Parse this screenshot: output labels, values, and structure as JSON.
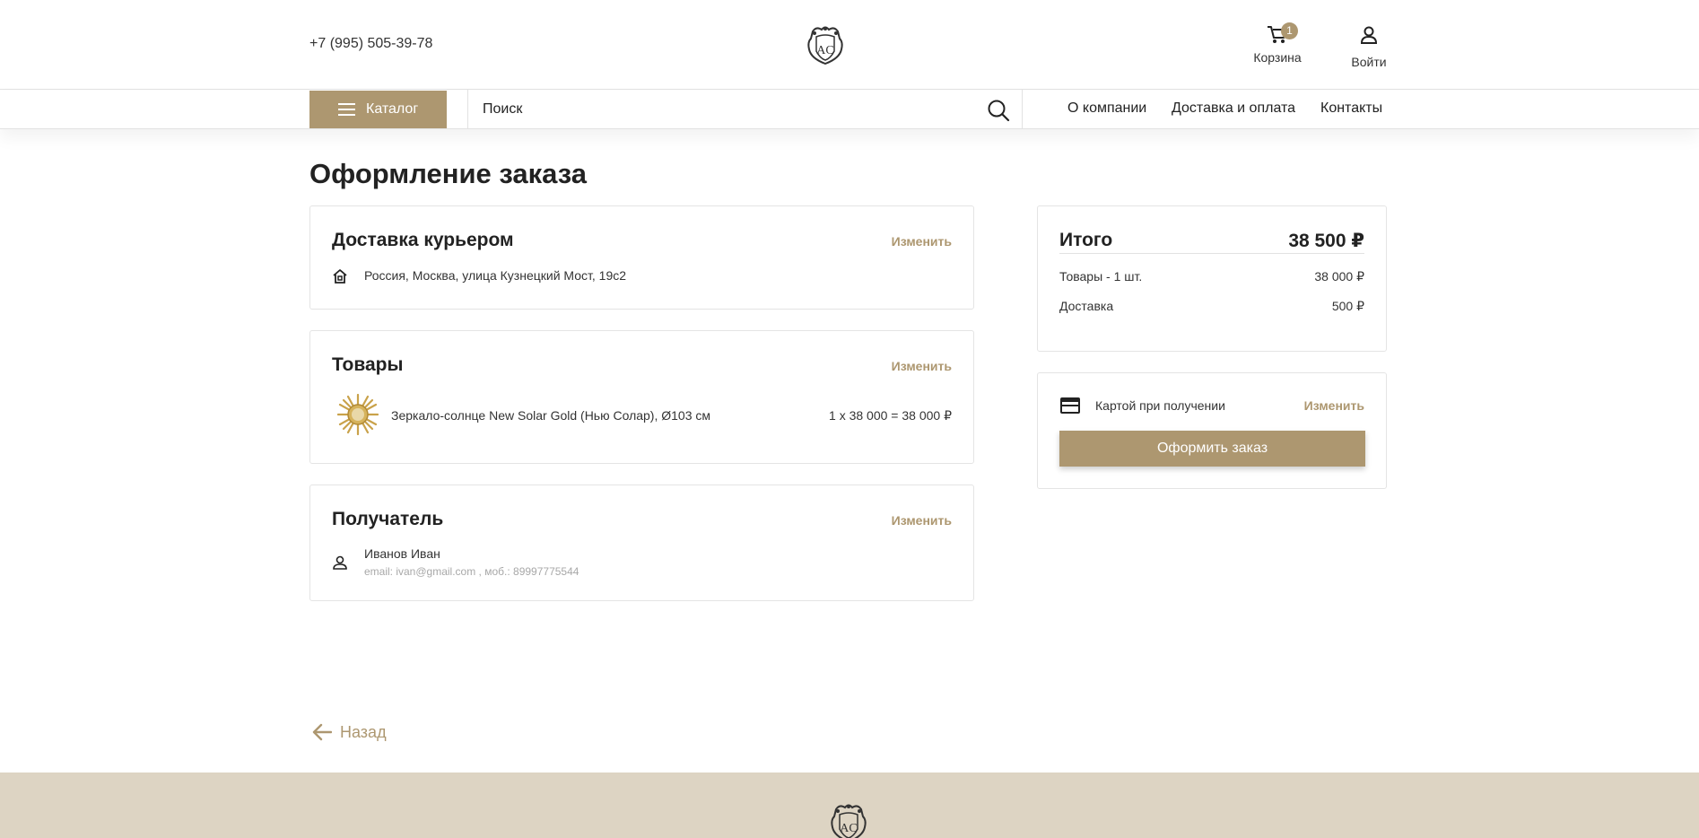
{
  "header": {
    "phone": "+7 (995) 505-39-78",
    "cart_label": "Корзина",
    "cart_count": "1",
    "login_label": "Войти"
  },
  "nav": {
    "catalog_label": "Каталог",
    "search_placeholder": "Поиск",
    "links": [
      "О компании",
      "Доставка и оплата",
      "Контакты"
    ]
  },
  "page": {
    "title": "Оформление заказа",
    "back_label": "Назад"
  },
  "delivery": {
    "title": "Доставка курьером",
    "edit_label": "Изменить",
    "address": "Россия, Москва, улица Кузнецкий Мост, 19с2"
  },
  "goods": {
    "title": "Товары",
    "edit_label": "Изменить",
    "items": [
      {
        "name": "Зеркало-солнце New Solar Gold (Нью Солар), Ø103 см",
        "price_line": "1 x 38 000 = 38 000 ₽"
      }
    ]
  },
  "recipient": {
    "title": "Получатель",
    "edit_label": "Изменить",
    "name": "Иванов Иван",
    "contacts": "email: ivan@gmail.com , моб.: 89997775544"
  },
  "summary": {
    "title": "Итого",
    "total": "38 500 ₽",
    "rows": [
      {
        "label": "Товары - 1 шт.",
        "value": "38 000 ₽"
      },
      {
        "label": "Доставка",
        "value": "500 ₽"
      }
    ]
  },
  "payment": {
    "method": "Картой при получении",
    "edit_label": "Изменить",
    "checkout_label": "Оформить заказ"
  },
  "colors": {
    "accent": "#ad9770",
    "footer_bg": "#ddd4c3",
    "text": "#222222",
    "muted": "#a8a8a8"
  },
  "icons": [
    "logo-crest-icon",
    "cart-icon",
    "user-icon",
    "menu-icon",
    "search-icon",
    "home-icon",
    "person-icon",
    "credit-card-icon",
    "arrow-left-icon"
  ]
}
